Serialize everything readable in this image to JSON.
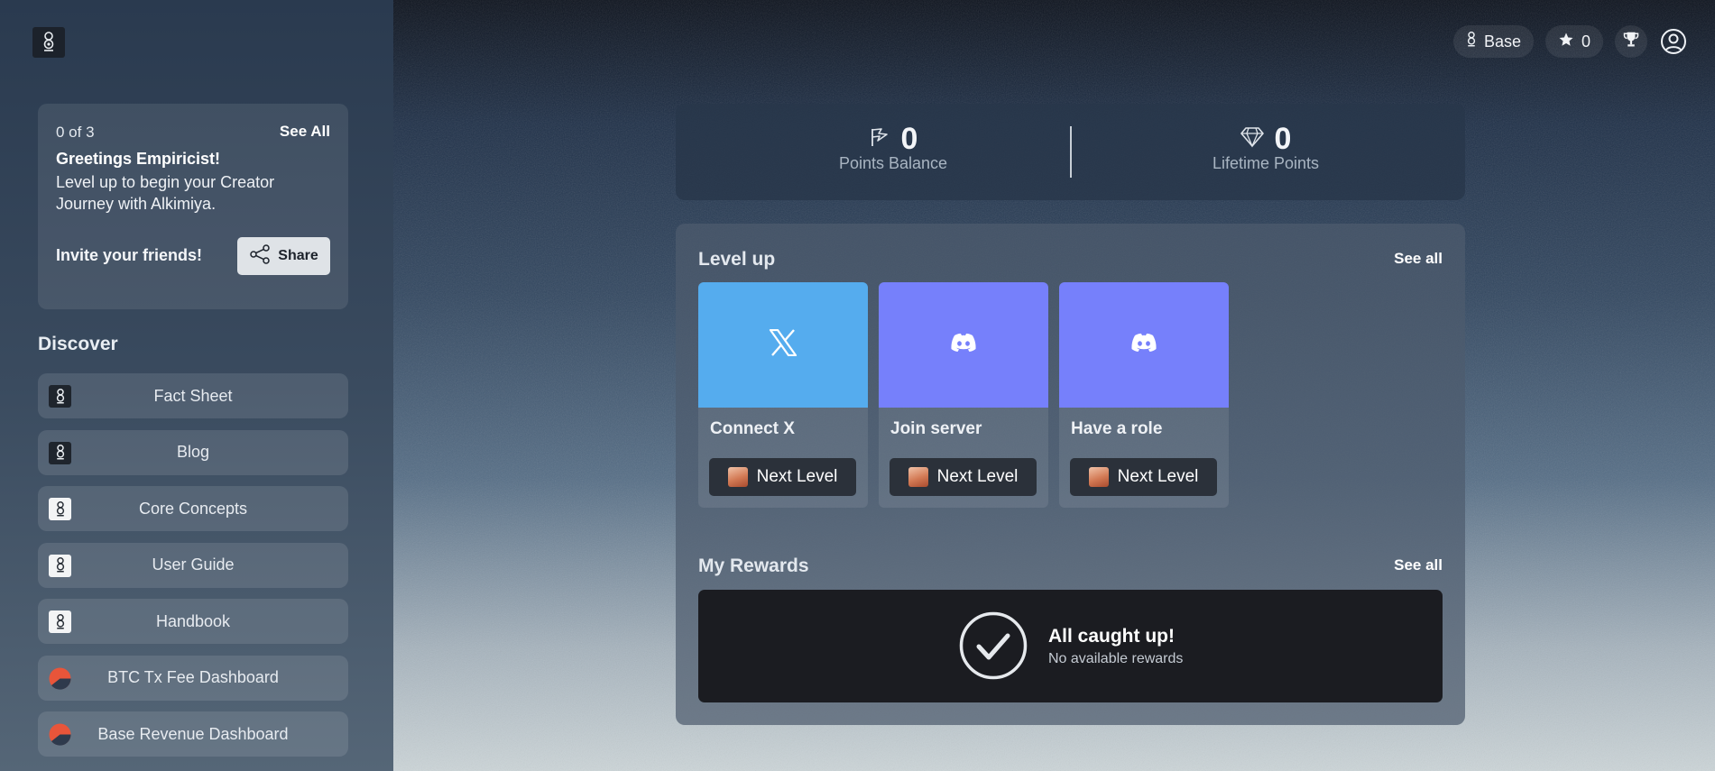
{
  "colors": {
    "x_banner": "#55acee",
    "discord_banner": "#7680fb",
    "share_button": "#dfe3e7",
    "rewards_box": "#1b1c21"
  },
  "sidebar": {
    "logo_icon": "alkimiya-logo-icon",
    "intro": {
      "progress": "0 of 3",
      "see_all": "See All",
      "greeting": "Greetings Empiricist!",
      "text": "Level up to begin your Creator Journey with Alkimiya.",
      "invite": "Invite your friends!",
      "share_label": "Share",
      "share_icon": "share-icon"
    },
    "discover_title": "Discover",
    "items": [
      {
        "label": "Fact Sheet",
        "icon": "alkimiya-logo-icon",
        "icon_style": "dark"
      },
      {
        "label": "Blog",
        "icon": "alkimiya-logo-icon",
        "icon_style": "dark"
      },
      {
        "label": "Core Concepts",
        "icon": "alkimiya-logo-icon",
        "icon_style": "light"
      },
      {
        "label": "User Guide",
        "icon": "alkimiya-logo-icon",
        "icon_style": "light"
      },
      {
        "label": "Handbook",
        "icon": "alkimiya-logo-icon",
        "icon_style": "light"
      },
      {
        "label": "BTC Tx Fee Dashboard",
        "icon": "pie-chart-icon",
        "icon_style": "pie"
      },
      {
        "label": "Base Revenue Dashboard",
        "icon": "pie-chart-icon",
        "icon_style": "pie"
      }
    ]
  },
  "header": {
    "network_label": "Base",
    "stars_count": "0"
  },
  "points": {
    "balance_value": "0",
    "balance_label": "Points Balance",
    "lifetime_value": "0",
    "lifetime_label": "Lifetime Points"
  },
  "level_up": {
    "title": "Level up",
    "see_all": "See all",
    "tasks": [
      {
        "label": "Connect X",
        "icon": "x-logo-icon",
        "button": "Next Level"
      },
      {
        "label": "Join server",
        "icon": "discord-icon",
        "button": "Next Level"
      },
      {
        "label": "Have a role",
        "icon": "discord-icon",
        "button": "Next Level"
      }
    ]
  },
  "rewards": {
    "title": "My Rewards",
    "see_all": "See all",
    "status_title": "All caught up!",
    "status_sub": "No available rewards"
  }
}
